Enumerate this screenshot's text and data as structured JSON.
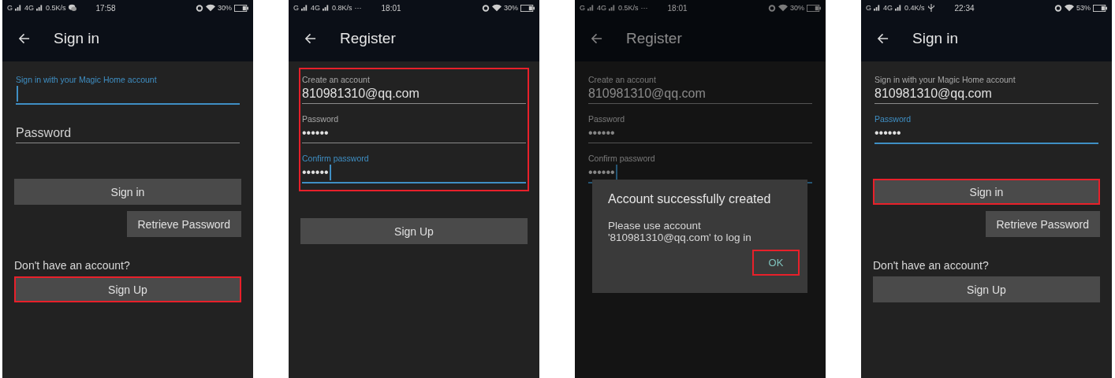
{
  "screens": [
    {
      "status": {
        "sim1": "G",
        "sim2": "4G",
        "speed": "0.5K/s",
        "notice": {
          "kind": "chat"
        },
        "time": "17:58",
        "battery": "30%"
      },
      "title": "Sign in",
      "form_highlighted": false,
      "content": [
        {
          "kind": "field",
          "label": "Sign in with your Magic Home account",
          "focused": true,
          "cursor": true
        },
        {
          "kind": "field",
          "placeholder": "Password",
          "focused": false,
          "cursor": false
        },
        {
          "kind": "button",
          "label": "Sign in",
          "highlighted": false
        },
        {
          "kind": "secondary_button",
          "label": "Retrieve Password",
          "highlighted": false
        },
        {
          "kind": "text",
          "label": "Don't have an account?"
        },
        {
          "kind": "button",
          "label": "Sign Up",
          "highlighted": true
        }
      ]
    },
    {
      "status": {
        "sim1": "G",
        "sim2": "4G",
        "speed": "0.8K/s",
        "notice": {
          "kind": "more",
          "label": "···"
        },
        "time": "18:01",
        "battery": "30%"
      },
      "title": "Register",
      "form_highlighted": true,
      "content": [
        {
          "kind": "field",
          "label": "Create an account",
          "value": "810981310@qq.com",
          "focused": false,
          "cursor": false
        },
        {
          "kind": "field",
          "label": "Password",
          "value": "••••••",
          "focused": false,
          "cursor": false
        },
        {
          "kind": "field",
          "label": "Confirm password",
          "value": "••••••",
          "focused": true,
          "cursor": true
        },
        {
          "kind": "button",
          "label": "Sign Up",
          "highlighted": false
        }
      ]
    },
    {
      "status": {
        "sim1": "G",
        "sim2": "4G",
        "speed": "0.5K/s",
        "notice": {
          "kind": "more",
          "label": "···"
        },
        "time": "18:01",
        "battery": "30%"
      },
      "title": "Register",
      "form_highlighted": false,
      "content": [
        {
          "kind": "field",
          "label": "Create an account",
          "value": "810981310@qq.com",
          "focused": false,
          "cursor": false
        },
        {
          "kind": "field",
          "label": "Password",
          "value": "••••••",
          "focused": false,
          "cursor": false
        },
        {
          "kind": "field",
          "label": "Confirm password",
          "value": "••••••",
          "focused": true,
          "cursor": true
        }
      ],
      "dialog": {
        "title": "Account successfully created",
        "message_lines": [
          "Please use account",
          "'810981310@qq.com' to log in"
        ],
        "button": {
          "label": "OK",
          "highlighted": true
        }
      }
    },
    {
      "status": {
        "sim1": "G",
        "sim2": "4G",
        "speed": "0.4K/s",
        "notice": {
          "kind": "usb"
        },
        "time": "22:34",
        "battery": "53%"
      },
      "title": "Sign in",
      "form_highlighted": false,
      "content": [
        {
          "kind": "field",
          "label": "Sign in with your Magic Home account",
          "value": "810981310@qq.com",
          "focused": false,
          "cursor": false
        },
        {
          "kind": "field",
          "label": "Password",
          "value": "••••••",
          "focused": true,
          "cursor": false
        },
        {
          "kind": "button",
          "label": "Sign in",
          "highlighted": true
        },
        {
          "kind": "secondary_button",
          "label": "Retrieve Password",
          "highlighted": false
        },
        {
          "kind": "text",
          "label": "Don't have an account?"
        },
        {
          "kind": "button",
          "label": "Sign Up",
          "highlighted": false
        }
      ]
    }
  ]
}
